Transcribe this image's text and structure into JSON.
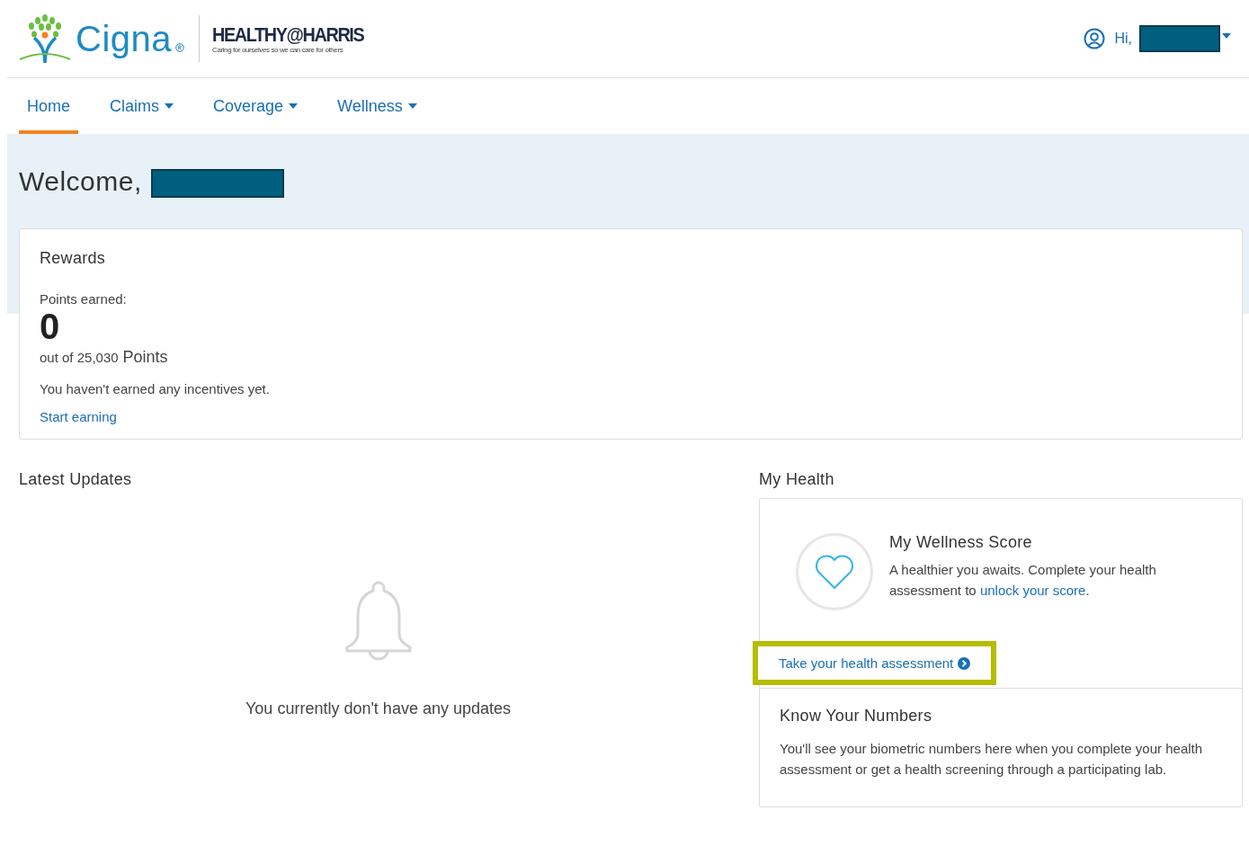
{
  "header": {
    "brand": "Cigna",
    "partner": {
      "title": "HEALTHY@HARRIS",
      "tagline": "Caring for ourselves so we can care for others"
    },
    "greeting": "Hi,",
    "name_redacted": true
  },
  "nav": [
    {
      "label": "Home",
      "selected": true,
      "dropdown": false
    },
    {
      "label": "Claims",
      "selected": false,
      "dropdown": true
    },
    {
      "label": "Coverage",
      "selected": false,
      "dropdown": true
    },
    {
      "label": "Wellness",
      "selected": false,
      "dropdown": true
    }
  ],
  "welcome": {
    "text": "Welcome,",
    "name_redacted": true
  },
  "rewards": {
    "title": "Rewards",
    "points_label": "Points earned:",
    "points": "0",
    "out_of": "out of 25,030",
    "unit": "Points",
    "message": "You haven't earned any incentives yet.",
    "link": "Start earning"
  },
  "latest_updates": {
    "title": "Latest Updates",
    "empty_message": "You currently don't have any updates"
  },
  "my_health": {
    "title": "My Health",
    "wellness": {
      "title": "My Wellness Score",
      "text_before": "A healthier you awaits. Complete your health assessment to ",
      "link": "unlock your score",
      "text_after": "."
    },
    "assessment_link": {
      "label": "Take your health assessment",
      "highlighted": true
    },
    "numbers": {
      "title": "Know Your Numbers",
      "text": "You'll see your biometric numbers here when you complete your health assessment or get a health screening through a participating lab."
    }
  }
}
